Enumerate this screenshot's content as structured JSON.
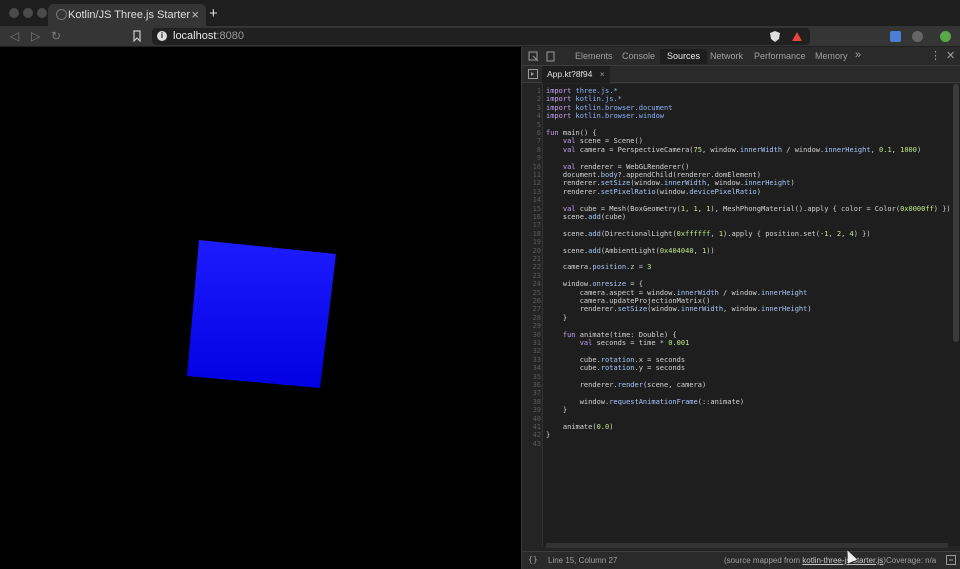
{
  "browser": {
    "tab_title": "Kotlin/JS Three.js Starter",
    "tab_close": "×",
    "new_tab": "+",
    "url_host": "localhost",
    "url_port": ":8080"
  },
  "scene": {
    "cube_color": "#0000ff"
  },
  "devtools": {
    "tabs": [
      "Elements",
      "Console",
      "Sources",
      "Network",
      "Performance",
      "Memory"
    ],
    "active_tab": "Sources",
    "more": "»",
    "file_tab": "App.kt?8f94",
    "file_close": "×",
    "status_position": "Line 15, Column 27",
    "status_source_prefix": "(source mapped from ",
    "status_source_link": "kotlin-three-js-starter.js",
    "status_source_suffix": ")",
    "status_coverage": "Coverage: n/a",
    "code_lines": [
      {
        "n": "1",
        "t": "import three.js.*"
      },
      {
        "n": "2",
        "t": "import kotlin.js.*"
      },
      {
        "n": "3",
        "t": "import kotlin.browser.document"
      },
      {
        "n": "4",
        "t": "import kotlin.browser.window"
      },
      {
        "n": "5",
        "t": ""
      },
      {
        "n": "6",
        "t": "fun main() {"
      },
      {
        "n": "7",
        "t": "    val scene = Scene()"
      },
      {
        "n": "8",
        "t": "    val camera = PerspectiveCamera(75, window.innerWidth / window.innerHeight, 0.1, 1000)"
      },
      {
        "n": "9",
        "t": ""
      },
      {
        "n": "10",
        "t": "    val renderer = WebGLRenderer()"
      },
      {
        "n": "11",
        "t": "    document.body?.appendChild(renderer.domElement)"
      },
      {
        "n": "12",
        "t": "    renderer.setSize(window.innerWidth, window.innerHeight)"
      },
      {
        "n": "13",
        "t": "    renderer.setPixelRatio(window.devicePixelRatio)"
      },
      {
        "n": "14",
        "t": ""
      },
      {
        "n": "15",
        "t": "    val cube = Mesh(BoxGeometry(1, 1, 1), MeshPhongMaterial().apply { color = Color(0x0000ff) })"
      },
      {
        "n": "16",
        "t": "    scene.add(cube)"
      },
      {
        "n": "17",
        "t": ""
      },
      {
        "n": "18",
        "t": "    scene.add(DirectionalLight(0xffffff, 1).apply { position.set(-1, 2, 4) })"
      },
      {
        "n": "19",
        "t": ""
      },
      {
        "n": "20",
        "t": "    scene.add(AmbientLight(0x404040, 1))"
      },
      {
        "n": "21",
        "t": ""
      },
      {
        "n": "22",
        "t": "    camera.position.z = 3"
      },
      {
        "n": "23",
        "t": ""
      },
      {
        "n": "24",
        "t": "    window.onresize = {"
      },
      {
        "n": "25",
        "t": "        camera.aspect = window.innerWidth / window.innerHeight"
      },
      {
        "n": "26",
        "t": "        camera.updateProjectionMatrix()"
      },
      {
        "n": "27",
        "t": "        renderer.setSize(window.innerWidth, window.innerHeight)"
      },
      {
        "n": "28",
        "t": "    }"
      },
      {
        "n": "29",
        "t": ""
      },
      {
        "n": "30",
        "t": "    fun animate(time: Double) {"
      },
      {
        "n": "31",
        "t": "        val seconds = time * 0.001"
      },
      {
        "n": "32",
        "t": ""
      },
      {
        "n": "33",
        "t": "        cube.rotation.x = seconds"
      },
      {
        "n": "34",
        "t": "        cube.rotation.y = seconds"
      },
      {
        "n": "35",
        "t": ""
      },
      {
        "n": "36",
        "t": "        renderer.render(scene, camera)"
      },
      {
        "n": "37",
        "t": ""
      },
      {
        "n": "38",
        "t": "        window.requestAnimationFrame(::animate)"
      },
      {
        "n": "39",
        "t": "    }"
      },
      {
        "n": "40",
        "t": ""
      },
      {
        "n": "41",
        "t": "    animate(0.0)"
      },
      {
        "n": "42",
        "t": "}"
      },
      {
        "n": "43",
        "t": ""
      }
    ]
  }
}
